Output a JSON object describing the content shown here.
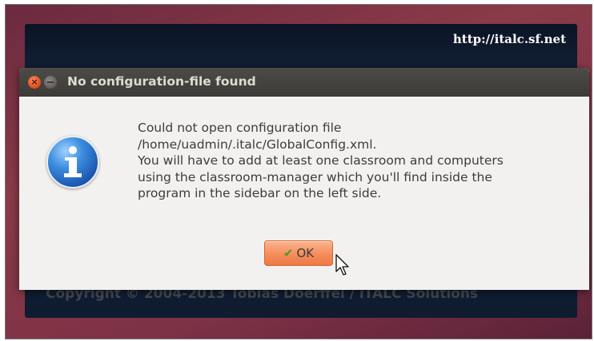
{
  "background": {
    "splash_url": "http://italc.sf.net",
    "splash_copyright": "Copyright © 2004-2013 Tobias Doerffel / iTALC Solutions"
  },
  "dialog": {
    "title": "No configuration-file found",
    "icon": "information-icon",
    "message_lines": [
      "Could not open configuration file",
      "/home/uadmin/.italc/GlobalConfig.xml.",
      "You will have to add at least one classroom and computers",
      "using the classroom-manager which you'll find inside the",
      "program in the sidebar on the left side."
    ],
    "ok_label": "OK",
    "window_buttons": [
      "close-icon",
      "minimize-icon"
    ]
  },
  "colors": {
    "ok_button": "#f48c5c",
    "titlebar": "#3c3b37",
    "close_button": "#df4a16",
    "desktop": "#7e3246"
  }
}
